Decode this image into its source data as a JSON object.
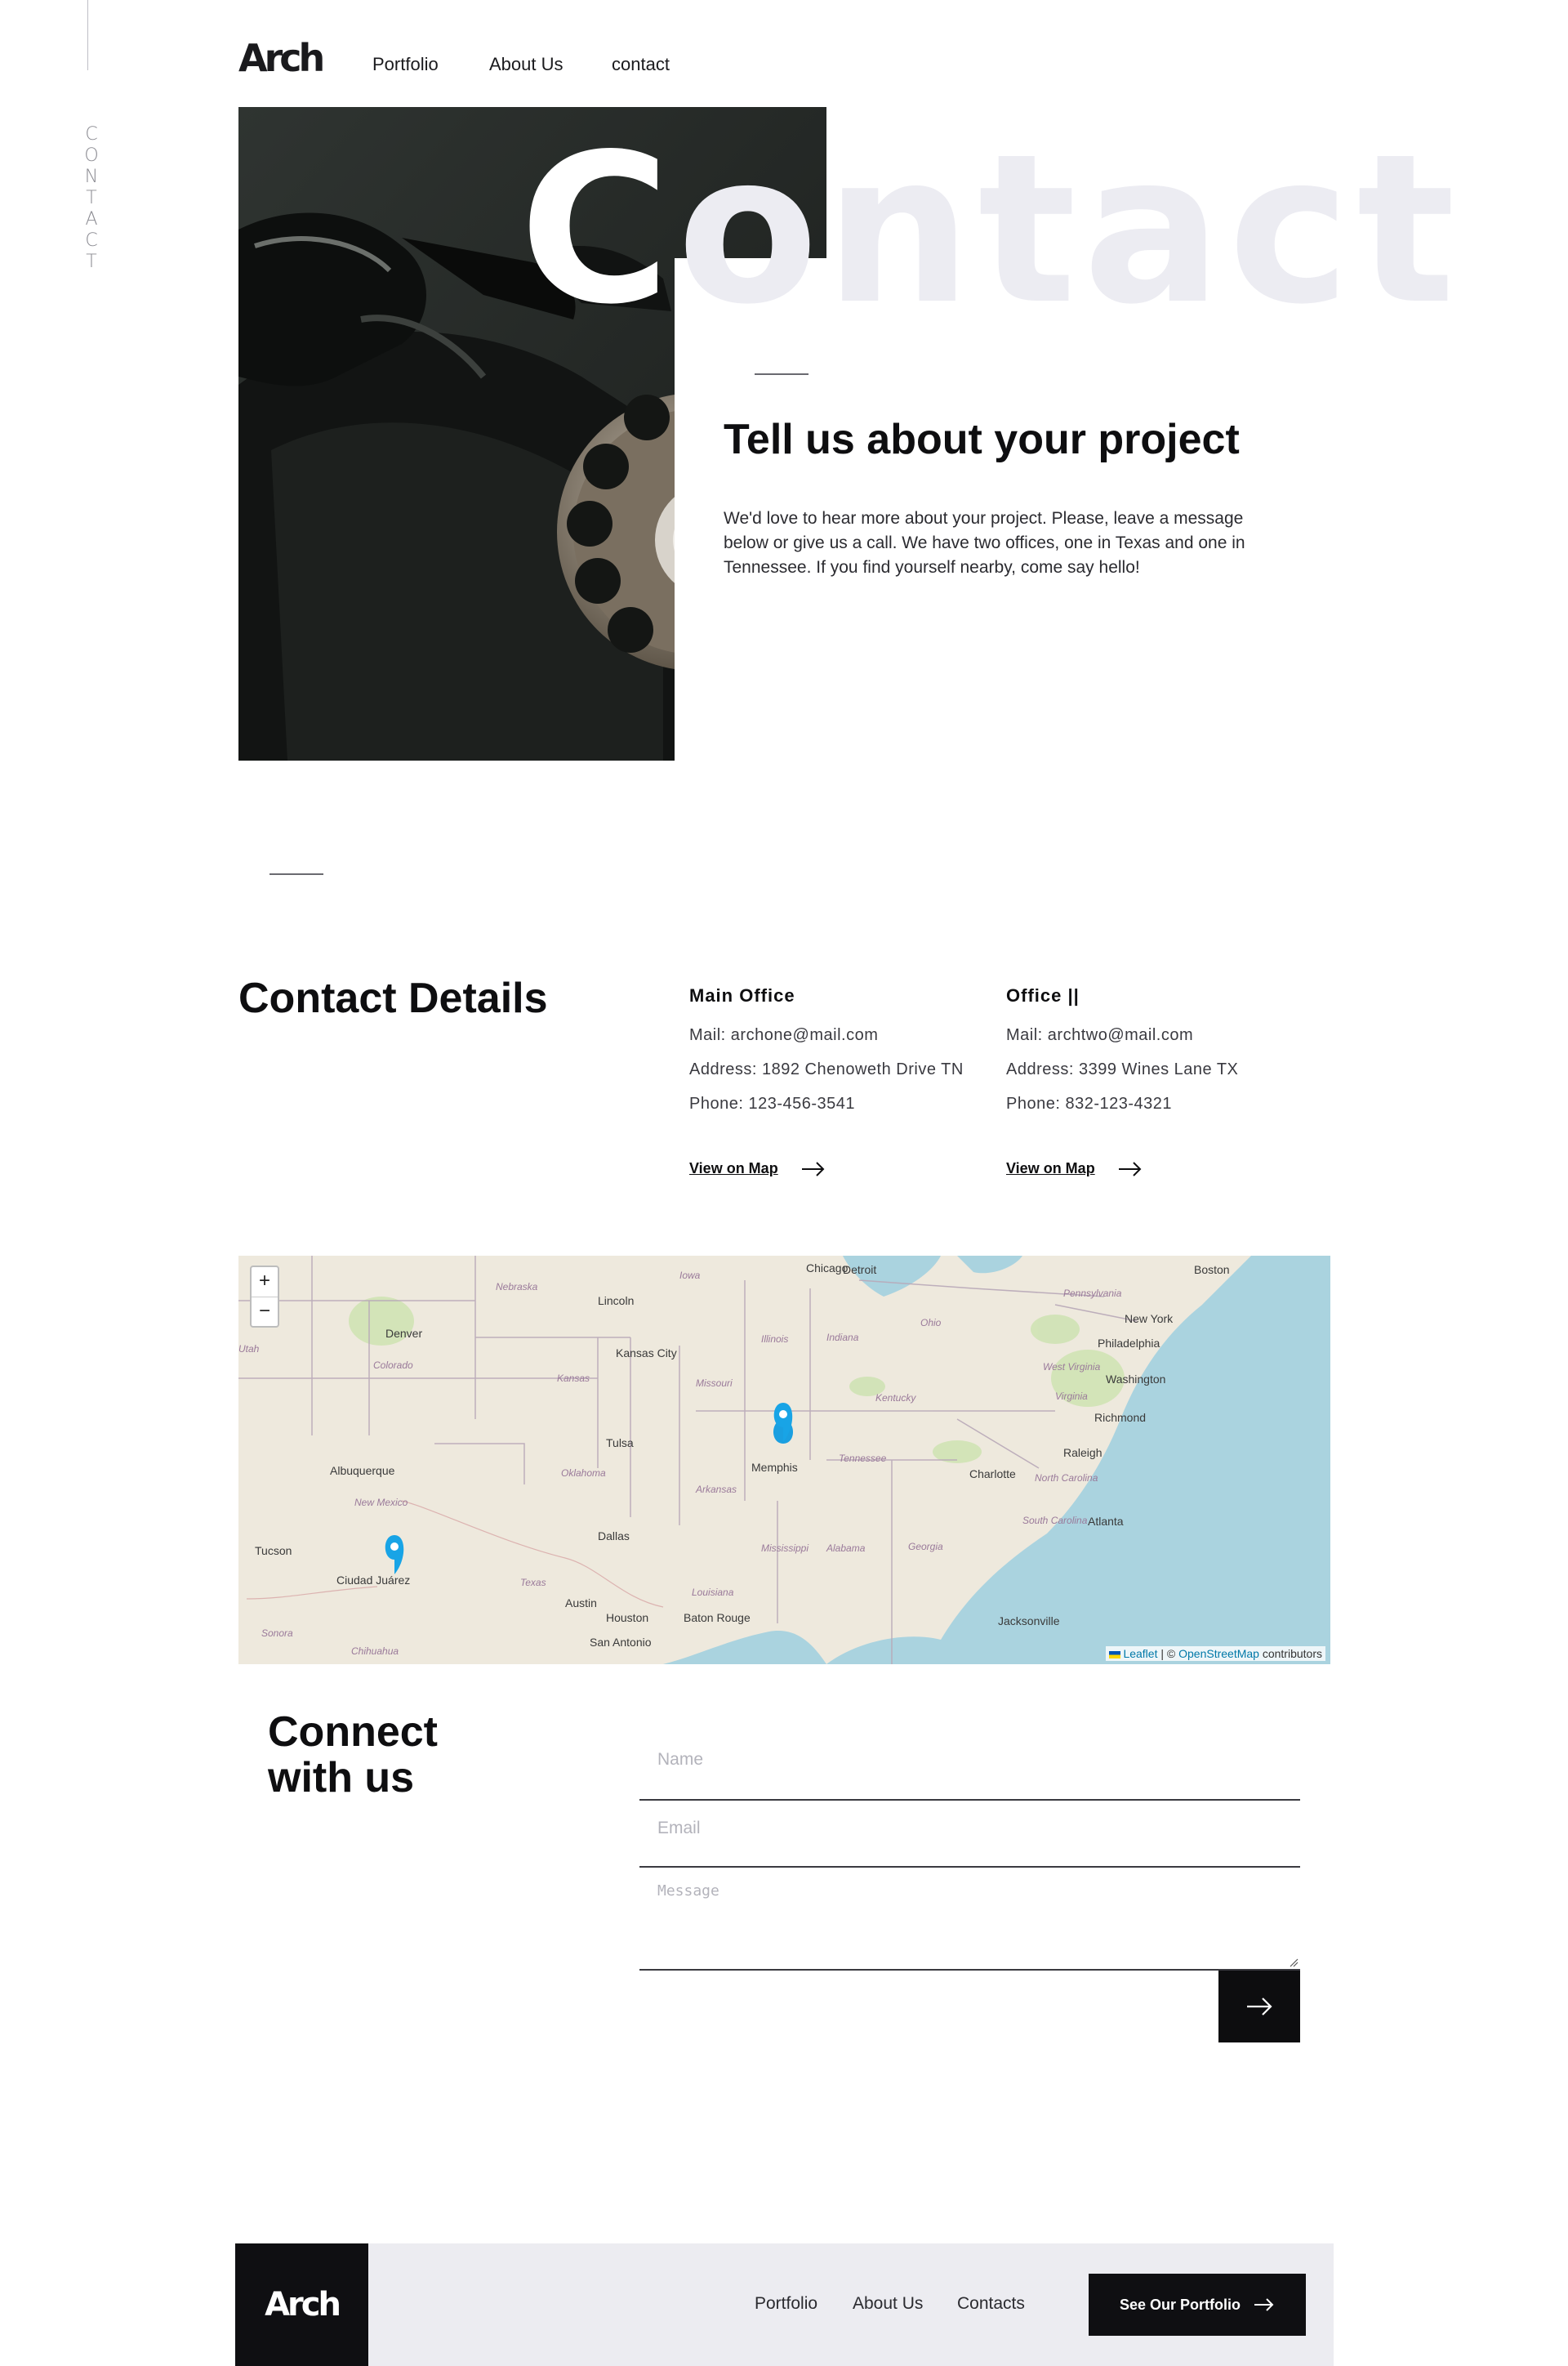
{
  "rail": {
    "label": "CONTACT"
  },
  "header": {
    "logo": "Arch",
    "nav": [
      "Portfolio",
      "About Us",
      "contact"
    ]
  },
  "hero": {
    "big_word": "Contact",
    "title": "Tell us about your project",
    "text": "We'd love to hear more about your project. Please, leave a message below or give us a call. We have two offices, one in Texas and one in Tennessee. If you find yourself nearby, come say hello!"
  },
  "details": {
    "title": "Contact Details",
    "offices": [
      {
        "name": "Main Office",
        "mail": "Mail: archone@mail.com",
        "address": "Address: 1892 Chenoweth Drive TN",
        "phone": "Phone: 123-456-3541",
        "link": "View on Map"
      },
      {
        "name": "Office ||",
        "mail": "Mail: archtwo@mail.com",
        "address": "Address: 3399 Wines Lane TX",
        "phone": "Phone: 832-123-4321",
        "link": "View on Map"
      }
    ]
  },
  "map": {
    "zoom_in": "+",
    "zoom_out": "−",
    "attribution_leaflet": "Leaflet",
    "attribution_sep": " | © ",
    "attribution_osm": "OpenStreetMap",
    "attribution_tail": " contributors",
    "cities": [
      "Detroit",
      "Chicago",
      "Boston",
      "Lincoln",
      "Denver",
      "New York",
      "Philadelphia",
      "Kansas City",
      "Washington",
      "Richmond",
      "Tulsa",
      "Memphis",
      "Raleigh",
      "Albuquerque",
      "Charlotte",
      "Atlanta",
      "Dallas",
      "Tucson",
      "Ciudad Juárez",
      "Austin",
      "Houston",
      "Baton Rouge",
      "San Antonio",
      "Jacksonville"
    ],
    "states": [
      "Iowa",
      "Nebraska",
      "Illinois",
      "Indiana",
      "Ohio",
      "Pennsylvania",
      "Colorado",
      "Kansas",
      "Missouri",
      "Kentucky",
      "West Virginia",
      "Virginia",
      "Oklahoma",
      "Tennessee",
      "Arkansas",
      "North Carolina",
      "New Mexico",
      "South Carolina",
      "Mississippi",
      "Alabama",
      "Georgia",
      "Louisiana",
      "Texas",
      "Sonora",
      "Chihuahua",
      "Utah"
    ]
  },
  "connect": {
    "title_line1": "Connect",
    "title_line2": "with us",
    "name_placeholder": "Name",
    "email_placeholder": "Email",
    "message_placeholder": "Message"
  },
  "footer": {
    "logo": "Arch",
    "links": [
      "Portfolio",
      "About Us",
      "Contacts"
    ],
    "cta": "See Our Portfolio"
  }
}
